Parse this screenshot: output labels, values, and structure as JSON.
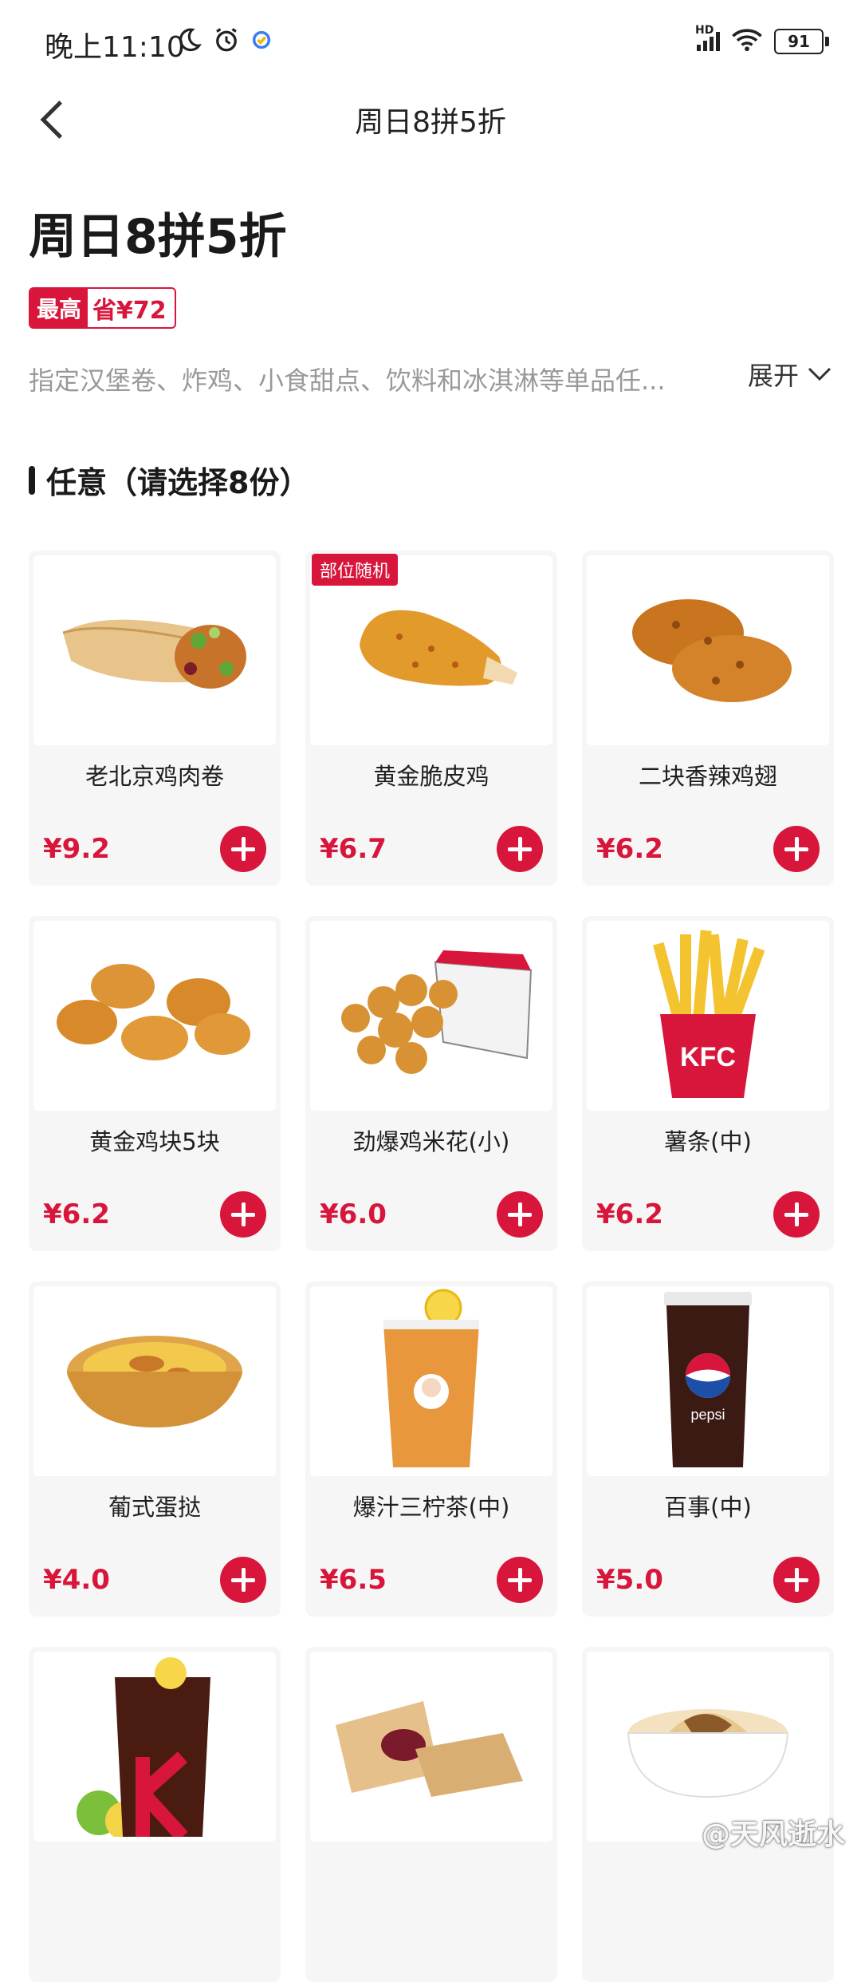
{
  "status_bar": {
    "time": "晚上11:10",
    "network": "HD",
    "battery": "91"
  },
  "nav": {
    "title": "周日8拼5折"
  },
  "promo": {
    "title": "周日8拼5折",
    "badge_tag": "最高",
    "badge_amount": "省¥72",
    "description": "指定汉堡卷、炸鸡、小食甜点、饮料和冰淇淋等单品任...",
    "expand_label": "展开"
  },
  "section": {
    "label": "任意（请选择8份）"
  },
  "colors": {
    "accent": "#d8163b",
    "card_bg": "#f6f6f6",
    "muted_text": "#999999"
  },
  "products": [
    {
      "name": "老北京鸡肉卷",
      "price": "¥9.2",
      "tag": "",
      "icon": "chicken-wrap-icon"
    },
    {
      "name": "黄金脆皮鸡",
      "price": "¥6.7",
      "tag": "部位随机",
      "icon": "fried-drumstick-icon"
    },
    {
      "name": "二块香辣鸡翅",
      "price": "¥6.2",
      "tag": "",
      "icon": "chicken-wings-icon"
    },
    {
      "name": "黄金鸡块5块",
      "price": "¥6.2",
      "tag": "",
      "icon": "chicken-nuggets-icon"
    },
    {
      "name": "劲爆鸡米花(小)",
      "price": "¥6.0",
      "tag": "",
      "icon": "popcorn-chicken-icon"
    },
    {
      "name": "薯条(中)",
      "price": "¥6.2",
      "tag": "",
      "icon": "fries-icon"
    },
    {
      "name": "葡式蛋挞",
      "price": "¥4.0",
      "tag": "",
      "icon": "egg-tart-icon"
    },
    {
      "name": "爆汁三柠茶(中)",
      "price": "¥6.5",
      "tag": "",
      "icon": "lemon-tea-icon"
    },
    {
      "name": "百事(中)",
      "price": "¥5.0",
      "tag": "",
      "icon": "pepsi-cup-icon"
    },
    {
      "name": "",
      "price": "",
      "tag": "",
      "icon": "iced-coffee-icon"
    },
    {
      "name": "",
      "price": "",
      "tag": "",
      "icon": "fruit-pie-icon"
    },
    {
      "name": "",
      "price": "",
      "tag": "",
      "icon": "mashed-potato-icon"
    }
  ],
  "watermark": "@天风逝水"
}
